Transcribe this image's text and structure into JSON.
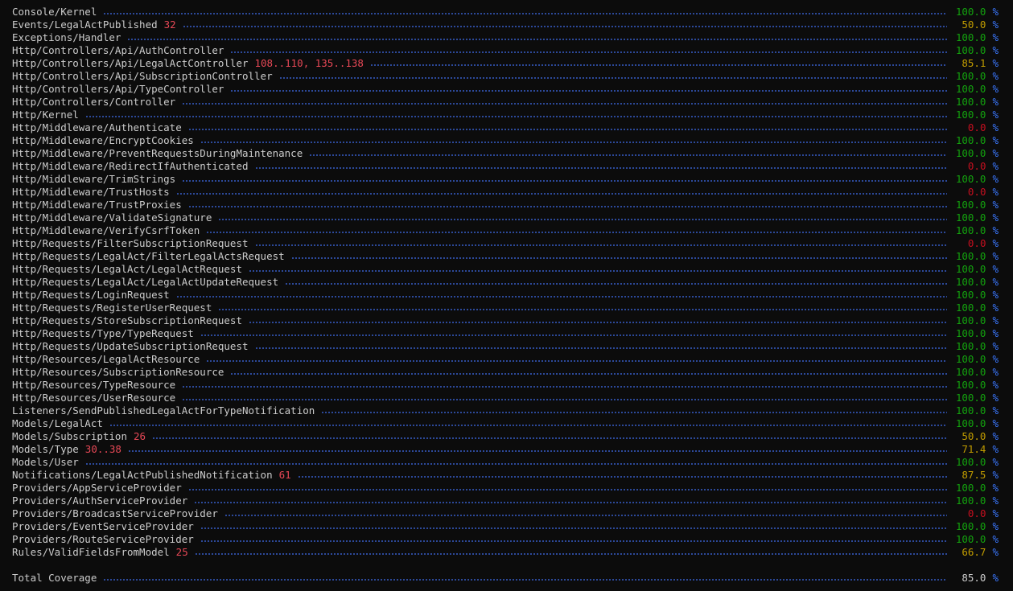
{
  "colors": {
    "background": "#0c0c0c",
    "text": "#cccccc",
    "uncovered_lines": "#e74856",
    "full": "#13a10e",
    "partial": "#c19c00",
    "zero": "#c50f1f",
    "dots": "#3a63d6",
    "percent_sign": "#3b78ff"
  },
  "rows": [
    {
      "name": "Console/Kernel",
      "lines": "",
      "pct": "100.0",
      "status": "full"
    },
    {
      "name": "Events/LegalActPublished",
      "lines": "32",
      "pct": "50.0",
      "status": "partial"
    },
    {
      "name": "Exceptions/Handler",
      "lines": "",
      "pct": "100.0",
      "status": "full"
    },
    {
      "name": "Http/Controllers/Api/AuthController",
      "lines": "",
      "pct": "100.0",
      "status": "full"
    },
    {
      "name": "Http/Controllers/Api/LegalActController",
      "lines": "108..110, 135..138",
      "pct": "85.1",
      "status": "partial"
    },
    {
      "name": "Http/Controllers/Api/SubscriptionController",
      "lines": "",
      "pct": "100.0",
      "status": "full"
    },
    {
      "name": "Http/Controllers/Api/TypeController",
      "lines": "",
      "pct": "100.0",
      "status": "full"
    },
    {
      "name": "Http/Controllers/Controller",
      "lines": "",
      "pct": "100.0",
      "status": "full"
    },
    {
      "name": "Http/Kernel",
      "lines": "",
      "pct": "100.0",
      "status": "full"
    },
    {
      "name": "Http/Middleware/Authenticate",
      "lines": "",
      "pct": "0.0",
      "status": "zero"
    },
    {
      "name": "Http/Middleware/EncryptCookies",
      "lines": "",
      "pct": "100.0",
      "status": "full"
    },
    {
      "name": "Http/Middleware/PreventRequestsDuringMaintenance",
      "lines": "",
      "pct": "100.0",
      "status": "full"
    },
    {
      "name": "Http/Middleware/RedirectIfAuthenticated",
      "lines": "",
      "pct": "0.0",
      "status": "zero"
    },
    {
      "name": "Http/Middleware/TrimStrings",
      "lines": "",
      "pct": "100.0",
      "status": "full"
    },
    {
      "name": "Http/Middleware/TrustHosts",
      "lines": "",
      "pct": "0.0",
      "status": "zero"
    },
    {
      "name": "Http/Middleware/TrustProxies",
      "lines": "",
      "pct": "100.0",
      "status": "full"
    },
    {
      "name": "Http/Middleware/ValidateSignature",
      "lines": "",
      "pct": "100.0",
      "status": "full"
    },
    {
      "name": "Http/Middleware/VerifyCsrfToken",
      "lines": "",
      "pct": "100.0",
      "status": "full"
    },
    {
      "name": "Http/Requests/FilterSubscriptionRequest",
      "lines": "",
      "pct": "0.0",
      "status": "zero"
    },
    {
      "name": "Http/Requests/LegalAct/FilterLegalActsRequest",
      "lines": "",
      "pct": "100.0",
      "status": "full"
    },
    {
      "name": "Http/Requests/LegalAct/LegalActRequest",
      "lines": "",
      "pct": "100.0",
      "status": "full"
    },
    {
      "name": "Http/Requests/LegalAct/LegalActUpdateRequest",
      "lines": "",
      "pct": "100.0",
      "status": "full"
    },
    {
      "name": "Http/Requests/LoginRequest",
      "lines": "",
      "pct": "100.0",
      "status": "full"
    },
    {
      "name": "Http/Requests/RegisterUserRequest",
      "lines": "",
      "pct": "100.0",
      "status": "full"
    },
    {
      "name": "Http/Requests/StoreSubscriptionRequest",
      "lines": "",
      "pct": "100.0",
      "status": "full"
    },
    {
      "name": "Http/Requests/Type/TypeRequest",
      "lines": "",
      "pct": "100.0",
      "status": "full"
    },
    {
      "name": "Http/Requests/UpdateSubscriptionRequest",
      "lines": "",
      "pct": "100.0",
      "status": "full"
    },
    {
      "name": "Http/Resources/LegalActResource",
      "lines": "",
      "pct": "100.0",
      "status": "full"
    },
    {
      "name": "Http/Resources/SubscriptionResource",
      "lines": "",
      "pct": "100.0",
      "status": "full"
    },
    {
      "name": "Http/Resources/TypeResource",
      "lines": "",
      "pct": "100.0",
      "status": "full"
    },
    {
      "name": "Http/Resources/UserResource",
      "lines": "",
      "pct": "100.0",
      "status": "full"
    },
    {
      "name": "Listeners/SendPublishedLegalActForTypeNotification",
      "lines": "",
      "pct": "100.0",
      "status": "full"
    },
    {
      "name": "Models/LegalAct",
      "lines": "",
      "pct": "100.0",
      "status": "full"
    },
    {
      "name": "Models/Subscription",
      "lines": "26",
      "pct": "50.0",
      "status": "partial"
    },
    {
      "name": "Models/Type",
      "lines": "30..38",
      "pct": "71.4",
      "status": "partial"
    },
    {
      "name": "Models/User",
      "lines": "",
      "pct": "100.0",
      "status": "full"
    },
    {
      "name": "Notifications/LegalActPublishedNotification",
      "lines": "61",
      "pct": "87.5",
      "status": "partial"
    },
    {
      "name": "Providers/AppServiceProvider",
      "lines": "",
      "pct": "100.0",
      "status": "full"
    },
    {
      "name": "Providers/AuthServiceProvider",
      "lines": "",
      "pct": "100.0",
      "status": "full"
    },
    {
      "name": "Providers/BroadcastServiceProvider",
      "lines": "",
      "pct": "0.0",
      "status": "zero"
    },
    {
      "name": "Providers/EventServiceProvider",
      "lines": "",
      "pct": "100.0",
      "status": "full"
    },
    {
      "name": "Providers/RouteServiceProvider",
      "lines": "",
      "pct": "100.0",
      "status": "full"
    },
    {
      "name": "Rules/ValidFieldsFromModel",
      "lines": "25",
      "pct": "66.7",
      "status": "partial"
    }
  ],
  "total": {
    "label": "Total Coverage",
    "pct": "85.0"
  },
  "percent_sign": "%"
}
